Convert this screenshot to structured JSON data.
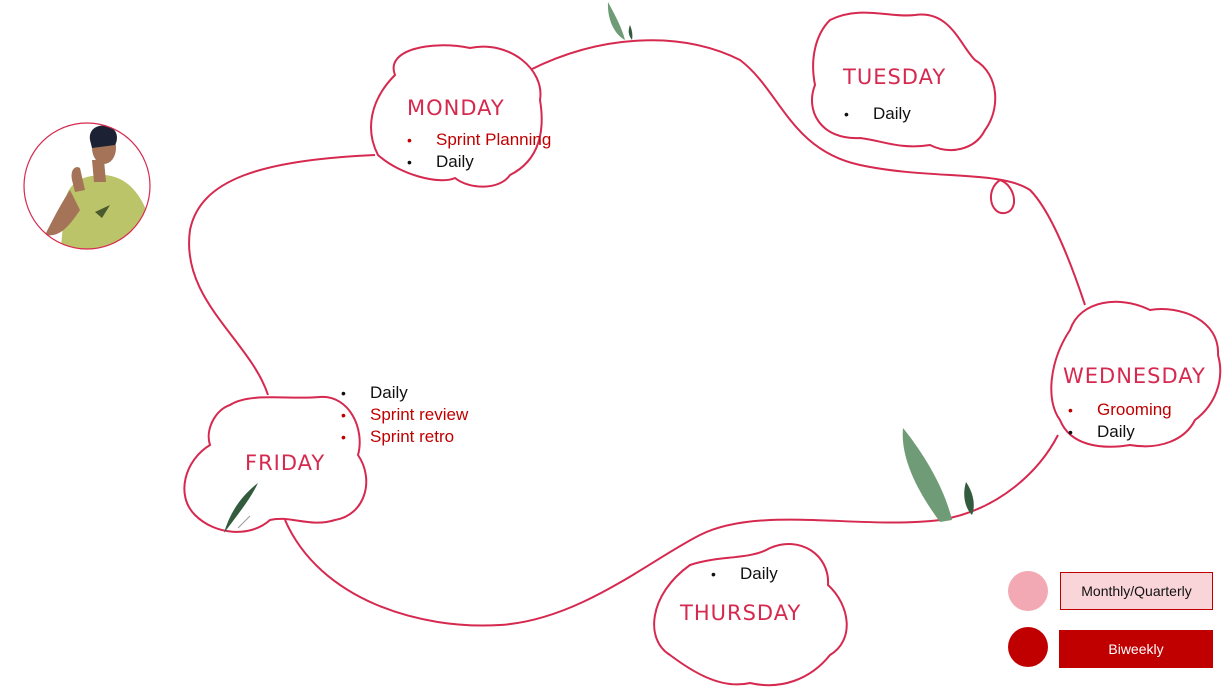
{
  "days": {
    "monday": {
      "title": "MONDAY",
      "items": [
        {
          "text": "Sprint Planning",
          "cadence": "biweekly"
        },
        {
          "text": "Daily",
          "cadence": "daily"
        }
      ]
    },
    "tuesday": {
      "title": "TUESDAY",
      "items": [
        {
          "text": "Daily",
          "cadence": "daily"
        }
      ]
    },
    "wednesday": {
      "title": "WEDNESDAY",
      "items": [
        {
          "text": "Grooming",
          "cadence": "biweekly"
        },
        {
          "text": "Daily",
          "cadence": "daily"
        }
      ]
    },
    "thursday": {
      "title": "THURSDAY",
      "items": [
        {
          "text": "Daily",
          "cadence": "daily"
        }
      ]
    },
    "friday": {
      "title": "FRIDAY",
      "items": [
        {
          "text": "Daily",
          "cadence": "daily"
        },
        {
          "text": "Sprint review",
          "cadence": "biweekly"
        },
        {
          "text": "Sprint retro",
          "cadence": "biweekly"
        }
      ]
    }
  },
  "legend": [
    {
      "label": "Monthly/Quarterly",
      "swatch_color": "#f2a9b3",
      "box_color": "#f9d5da",
      "text_color": "#111111"
    },
    {
      "label": "Biweekly",
      "swatch_color": "#c00000",
      "box_color": "#c00000",
      "text_color": "#ffffff"
    }
  ],
  "colors": {
    "outline": "#d6294f",
    "title": "#d6294f",
    "biweekly_text": "#c00000",
    "daily_text": "#111111",
    "leaf_light": "#6f9c76",
    "leaf_dark": "#335c3e",
    "shirt": "#bcc46a",
    "skin": "#a47358",
    "hair": "#1c2233"
  },
  "icons": {
    "avatar": "person-thumbs-up-illustration",
    "decoration": "leaf-icon"
  }
}
